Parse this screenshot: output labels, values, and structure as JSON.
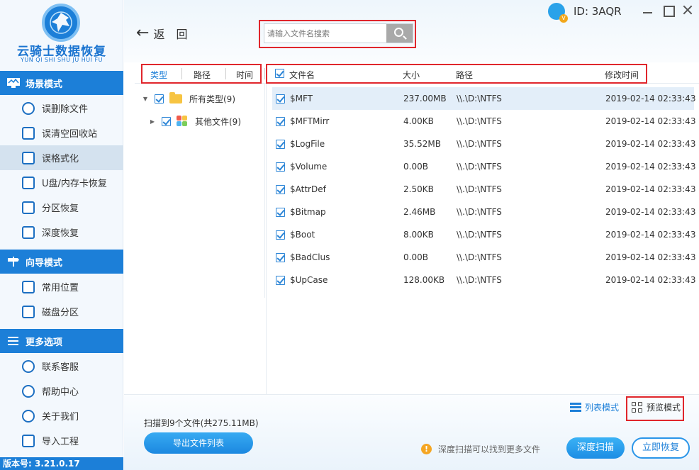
{
  "app": {
    "logo_title": "云骑士数据恢复",
    "logo_subtitle": "YUN QI SHI SHU JU HUI FU",
    "version": "版本号: 3.21.0.17",
    "user_id": "ID: 3AQR"
  },
  "sidebar": {
    "sections": [
      {
        "title": "场景模式",
        "items": [
          {
            "label": "误删除文件",
            "icon": "deleted-file-icon"
          },
          {
            "label": "误清空回收站",
            "icon": "recycle-bin-icon"
          },
          {
            "label": "误格式化",
            "icon": "format-disk-icon",
            "active": true
          },
          {
            "label": "U盘/内存卡恢复",
            "icon": "usb-card-icon"
          },
          {
            "label": "分区恢复",
            "icon": "partition-icon"
          },
          {
            "label": "深度恢复",
            "icon": "deep-recover-icon"
          }
        ]
      },
      {
        "title": "向导模式",
        "items": [
          {
            "label": "常用位置",
            "icon": "common-location-icon"
          },
          {
            "label": "磁盘分区",
            "icon": "disk-partition-icon"
          }
        ]
      },
      {
        "title": "更多选项",
        "items": [
          {
            "label": "联系客服",
            "icon": "customer-service-icon"
          },
          {
            "label": "帮助中心",
            "icon": "help-icon"
          },
          {
            "label": "关于我们",
            "icon": "about-icon"
          },
          {
            "label": "导入工程",
            "icon": "import-project-icon"
          }
        ]
      }
    ]
  },
  "toolbar": {
    "back_label": "返　回",
    "search_placeholder": "请输入文件名搜索"
  },
  "tree_header": {
    "type": "类型",
    "path": "路径",
    "time": "时间"
  },
  "tree": [
    {
      "label": "所有类型(9)",
      "expanded": true
    },
    {
      "label": "其他文件(9)",
      "expanded": false
    }
  ],
  "table": {
    "columns": [
      "文件名",
      "大小",
      "路径",
      "修改时间"
    ],
    "rows": [
      {
        "name": "$MFT",
        "size": "237.00MB",
        "path": "\\\\.\\D:\\NTFS",
        "time": "2019-02-14 02:33:43",
        "selected": true
      },
      {
        "name": "$MFTMirr",
        "size": "4.00KB",
        "path": "\\\\.\\D:\\NTFS",
        "time": "2019-02-14 02:33:43"
      },
      {
        "name": "$LogFile",
        "size": "35.52MB",
        "path": "\\\\.\\D:\\NTFS",
        "time": "2019-02-14 02:33:43"
      },
      {
        "name": "$Volume",
        "size": "0.00B",
        "path": "\\\\.\\D:\\NTFS",
        "time": "2019-02-14 02:33:43"
      },
      {
        "name": "$AttrDef",
        "size": "2.50KB",
        "path": "\\\\.\\D:\\NTFS",
        "time": "2019-02-14 02:33:43"
      },
      {
        "name": "$Bitmap",
        "size": "2.46MB",
        "path": "\\\\.\\D:\\NTFS",
        "time": "2019-02-14 02:33:43"
      },
      {
        "name": "$Boot",
        "size": "8.00KB",
        "path": "\\\\.\\D:\\NTFS",
        "time": "2019-02-14 02:33:43"
      },
      {
        "name": "$BadClus",
        "size": "0.00B",
        "path": "\\\\.\\D:\\NTFS",
        "time": "2019-02-14 02:33:43"
      },
      {
        "name": "$UpCase",
        "size": "128.00KB",
        "path": "\\\\.\\D:\\NTFS",
        "time": "2019-02-14 02:33:43"
      }
    ]
  },
  "footer": {
    "scan_status": "扫描到9个文件(共275.11MB)",
    "export_label": "导出文件列表",
    "list_mode_label": "列表模式",
    "preview_mode_label": "预览模式",
    "deep_tip": "深度扫描可以找到更多文件",
    "deep_scan_label": "深度扫描",
    "recover_label": "立即恢复"
  },
  "colors": {
    "accent": "#1c7fd8",
    "highlight_box": "#e0262c",
    "selected_row": "#e3eef9",
    "active_nav": "#d4e2ef"
  }
}
